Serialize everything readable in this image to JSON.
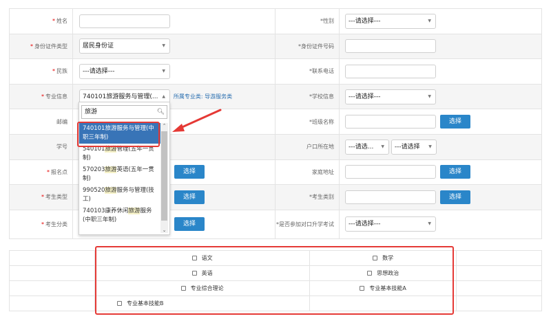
{
  "form": {
    "name_label": "姓名",
    "gender_label": "性别",
    "gender_value": "---请选择---",
    "id_type_label": "身份证件类型",
    "id_type_value": "居民身份证",
    "id_number_label": "身份证件号码",
    "ethnicity_label": "民族",
    "ethnicity_value": "---请选择---",
    "phone_label": "联系电话",
    "major_label": "专业信息",
    "major_value": "740101旅游服务与管理(...",
    "major_category_hint": "所属专业类: 导游服务类",
    "school_label": "学校信息",
    "school_value": "---请选择---",
    "postcode_label": "邮编",
    "class_label": "班级名称",
    "class_button": "选择",
    "student_no_label": "学号",
    "hukou_label": "户口所在地",
    "hukou_province": "---请选...",
    "hukou_city": "---请选择",
    "exam_site_label": "报名点",
    "exam_site_button": "选择",
    "home_address_label": "家庭地址",
    "home_address_button": "选择",
    "examinee_type_label": "考生类型",
    "examinee_type_button": "选择",
    "examinee_category_label": "考生类别",
    "examinee_category_button": "选择",
    "examinee_class_label": "考生分类",
    "examinee_class_button": "选择",
    "vocational_exam_label": "是否参加对口升学考试",
    "vocational_exam_value": "---请选择---"
  },
  "dropdown": {
    "search_value": "旅游",
    "items": [
      {
        "code": "740101",
        "pre": "",
        "hl": "旅游",
        "post": "服务与管理(中职三年制)",
        "selected": true
      },
      {
        "code": "540101",
        "pre": "",
        "hl": "旅游",
        "post": "管理(五年一贯制)",
        "selected": false
      },
      {
        "code": "570203",
        "pre": "",
        "hl": "旅游",
        "post": "英语(五年一贯制)",
        "selected": false
      },
      {
        "code": "990520",
        "pre": "",
        "hl": "旅游",
        "post": "服务与管理(技工)",
        "selected": false
      },
      {
        "code": "740103",
        "pre": "康养休闲",
        "hl": "旅游",
        "post": "服务(中职三年制)",
        "selected": false
      }
    ]
  },
  "subjects": {
    "chinese": "语文",
    "math": "数学",
    "english": "英语",
    "politics": "思想政治",
    "theory": "专业综合理论",
    "skill_a": "专业基本技能A",
    "skill_b": "专业基本技能B"
  },
  "colors": {
    "required_star": "#e60000",
    "button_blue": "#2a86c9",
    "selected_item": "#3874b7",
    "annotation_red": "#e53935"
  },
  "icons": [
    "search-icon",
    "chevron-down-icon",
    "chevron-up-icon",
    "annotation-arrow"
  ]
}
